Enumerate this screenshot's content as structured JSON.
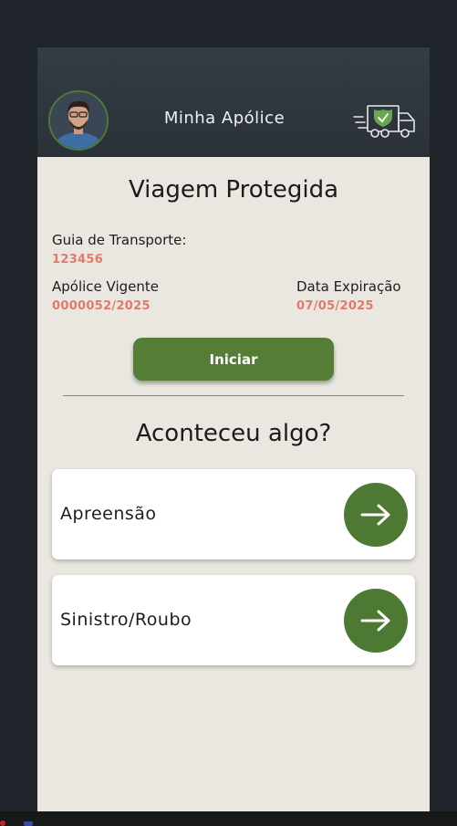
{
  "header": {
    "title": "Minha Apólice",
    "avatar_icon": "user-avatar",
    "logo_icon": "delivery-truck-shield-icon"
  },
  "policy": {
    "title": "Viagem Protegida",
    "transport_guide_label": "Guia de Transporte:",
    "transport_guide_value": "123456",
    "policy_label": "Apólice Vigente",
    "policy_value": "0000052/2025",
    "expiration_label": "Data Expiração",
    "expiration_value": "07/05/2025",
    "start_button": "Iniciar"
  },
  "incidents": {
    "title": "Aconteceu algo?",
    "items": [
      {
        "label": "Apreensão",
        "icon": "arrow-right-icon"
      },
      {
        "label": "Sinistro/Roubo",
        "icon": "arrow-right-icon"
      }
    ]
  },
  "colors": {
    "accent_green": "#557d36",
    "value_red": "#e17a6d",
    "header_bg": "#2f363e",
    "content_bg": "#e9e7df"
  }
}
